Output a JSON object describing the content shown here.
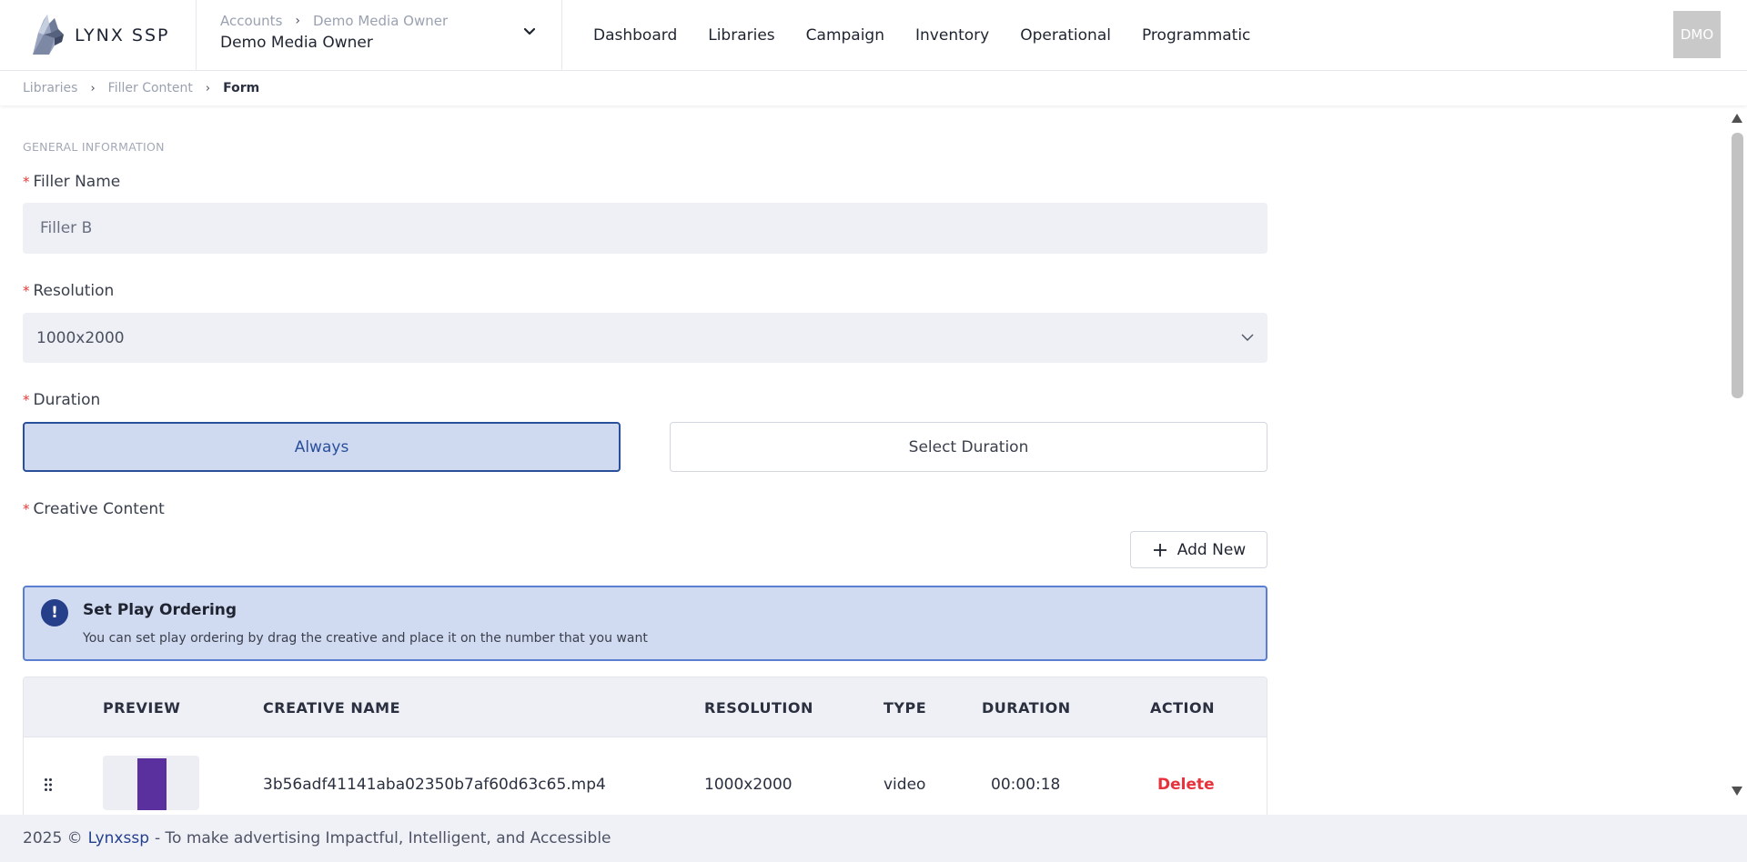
{
  "header": {
    "brand_name": "LYNX SSP",
    "account_crumbs": [
      "Accounts",
      "Demo Media Owner"
    ],
    "account_name": "Demo Media Owner",
    "nav": [
      "Dashboard",
      "Libraries",
      "Campaign",
      "Inventory",
      "Operational",
      "Programmatic"
    ],
    "avatar": "DMO"
  },
  "breadcrumb": [
    "Libraries",
    "Filler Content",
    "Form"
  ],
  "form": {
    "section_title": "GENERAL INFORMATION",
    "filler_name_label": "Filler Name",
    "filler_name_value": "Filler B",
    "resolution_label": "Resolution",
    "resolution_value": "1000x2000",
    "duration_label": "Duration",
    "duration_options": [
      "Always",
      "Select Duration"
    ],
    "duration_selected": "Always",
    "creative_label": "Creative Content",
    "add_new": "Add New",
    "required_marker": "*"
  },
  "info": {
    "title": "Set Play Ordering",
    "text": "You can set play ordering by drag the creative and place it on the number that you want"
  },
  "table": {
    "headers": [
      "PREVIEW",
      "CREATIVE NAME",
      "RESOLUTION",
      "TYPE",
      "DURATION",
      "ACTION"
    ],
    "rows": [
      {
        "creative_name": "3b56adf41141aba02350b7af60d63c65.mp4",
        "resolution": "1000x2000",
        "type": "video",
        "duration": "00:00:18",
        "action": "Delete"
      }
    ]
  },
  "footer": {
    "prefix": "2025 ©",
    "brand": "Lynxssp",
    "suffix": "- To make advertising Impactful, Intelligent, and Accessible"
  },
  "colors": {
    "primary": "#2a4f9b",
    "info_bg": "#d0dbf2",
    "danger": "#e8323c",
    "input_bg": "#eff0f5"
  },
  "icons": [
    "lynx-logo-icon",
    "chevron-right-icon",
    "chevron-down-icon",
    "plus-icon",
    "exclamation-icon",
    "drag-handle-icon",
    "scroll-up-icon",
    "scroll-down-icon"
  ]
}
